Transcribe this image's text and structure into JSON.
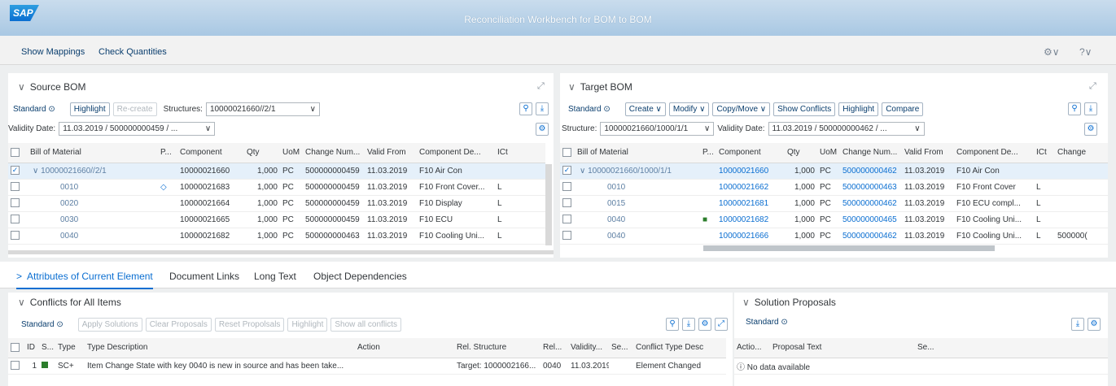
{
  "app": {
    "logo": "SAP",
    "title": "Reconciliation Workbench for BOM to BOM"
  },
  "subheader": {
    "show_mappings": "Show Mappings",
    "check_quantities": "Check Quantities",
    "settings_icon": "⚙∨",
    "help_icon": "?∨"
  },
  "source": {
    "title": "Source BOM",
    "standard": "Standard ⊙",
    "highlight": "Highlight",
    "recreate": "Re-create",
    "structures_label": "Structures:",
    "structures_value": "10000021660//2/1",
    "validity_label": "Validity Date:",
    "validity_value": "11.03.2019 / 500000000459 / ...",
    "headers": [
      "Bill of Material",
      "P...",
      "Component",
      "Qty",
      "UoM",
      "Change Num...",
      "Valid From",
      "Component De...",
      "ICt"
    ],
    "rows": [
      {
        "bom": "∨ 10000021660//2/1",
        "p": "",
        "comp": "10000021660",
        "qty": "1,000",
        "uom": "PC",
        "chg": "500000000459",
        "from": "11.03.2019",
        "desc": "F10 Air Con",
        "ict": "",
        "checked": "✓"
      },
      {
        "bom": "0010",
        "p": "◇",
        "comp": "10000021683",
        "qty": "1,000",
        "uom": "PC",
        "chg": "500000000459",
        "from": "11.03.2019",
        "desc": "F10 Front Cover...",
        "ict": "L",
        "checked": ""
      },
      {
        "bom": "0020",
        "p": "",
        "comp": "10000021664",
        "qty": "1,000",
        "uom": "PC",
        "chg": "500000000459",
        "from": "11.03.2019",
        "desc": "F10 Display",
        "ict": "L",
        "checked": ""
      },
      {
        "bom": "0030",
        "p": "",
        "comp": "10000021665",
        "qty": "1,000",
        "uom": "PC",
        "chg": "500000000459",
        "from": "11.03.2019",
        "desc": "F10 ECU",
        "ict": "L",
        "checked": ""
      },
      {
        "bom": "0040",
        "p": "",
        "comp": "10000021682",
        "qty": "1,000",
        "uom": "PC",
        "chg": "500000000463",
        "from": "11.03.2019",
        "desc": "F10 Cooling Uni...",
        "ict": "L",
        "checked": ""
      }
    ]
  },
  "target": {
    "title": "Target BOM",
    "standard": "Standard ⊙",
    "create": "Create ∨",
    "modify": "Modify ∨",
    "copymove": "Copy/Move ∨",
    "show_conflicts": "Show Conflicts",
    "highlight": "Highlight",
    "compare": "Compare",
    "structure_label": "Structure:",
    "structure_value": "10000021660/1000/1/1",
    "validity_label": "Validity Date:",
    "validity_value": "11.03.2019 / 500000000462 / ...",
    "headers": [
      "Bill of Material",
      "P...",
      "Component",
      "Qty",
      "UoM",
      "Change Num...",
      "Valid From",
      "Component De...",
      "ICt",
      "Change"
    ],
    "rows": [
      {
        "bom": "∨ 10000021660/1000/1/1",
        "p": "",
        "comp": "10000021660",
        "qty": "1,000",
        "uom": "PC",
        "chg": "500000000462",
        "from": "11.03.2019",
        "desc": "F10 Air Con",
        "ict": "",
        "extra": "",
        "checked": "✓"
      },
      {
        "bom": "0010",
        "p": "",
        "comp": "10000021662",
        "qty": "1,000",
        "uom": "PC",
        "chg": "500000000463",
        "from": "11.03.2019",
        "desc": "F10 Front Cover",
        "ict": "L",
        "extra": "",
        "checked": ""
      },
      {
        "bom": "0015",
        "p": "",
        "comp": "10000021681",
        "qty": "1,000",
        "uom": "PC",
        "chg": "500000000462",
        "from": "11.03.2019",
        "desc": "F10 ECU compl...",
        "ict": "L",
        "extra": "",
        "checked": ""
      },
      {
        "bom": "0040",
        "p": "■",
        "comp": "10000021682",
        "qty": "1,000",
        "uom": "PC",
        "chg": "500000000465",
        "from": "11.03.2019",
        "desc": "F10 Cooling Uni...",
        "ict": "L",
        "extra": "",
        "checked": ""
      },
      {
        "bom": "0040",
        "p": "",
        "comp": "10000021666",
        "qty": "1,000",
        "uom": "PC",
        "chg": "500000000462",
        "from": "11.03.2019",
        "desc": "F10 Cooling Uni...",
        "ict": "L",
        "extra": "500000(",
        "checked": ""
      }
    ]
  },
  "tabs": [
    "Attributes of Current Element",
    "Document Links",
    "Long Text",
    "Object Dependencies"
  ],
  "conflicts": {
    "title": "Conflicts for All Items",
    "standard": "Standard ⊙",
    "apply": "Apply Solutions",
    "clear": "Clear Proposals",
    "reset": "Reset Propolsals",
    "highlight": "Highlight",
    "show_all": "Show all conflicts",
    "headers": [
      "ID",
      "S...",
      "Type",
      "Type Description",
      "Action",
      "Rel. Structure",
      "Rel...",
      "Validity...",
      "Se...",
      "Conflict Type Desc"
    ],
    "rows": [
      {
        "id": "1",
        "type": "SC+",
        "desc": "Item Change State with key 0040 is new in source and has been take...",
        "action": "",
        "rel": "Target: 1000002166...",
        "rel2": "0040",
        "valid": "11.03.2019",
        "se": "",
        "ctype": "Element Changed"
      }
    ]
  },
  "proposals": {
    "title": "Solution Proposals",
    "standard": "Standard ⊙",
    "headers": [
      "Actio...",
      "Proposal Text",
      "Se..."
    ],
    "empty": "No data available"
  },
  "colors": {
    "accent": "#0a6ed1",
    "status_green": "#2b7d2b",
    "shell": "#a9c8e3"
  }
}
